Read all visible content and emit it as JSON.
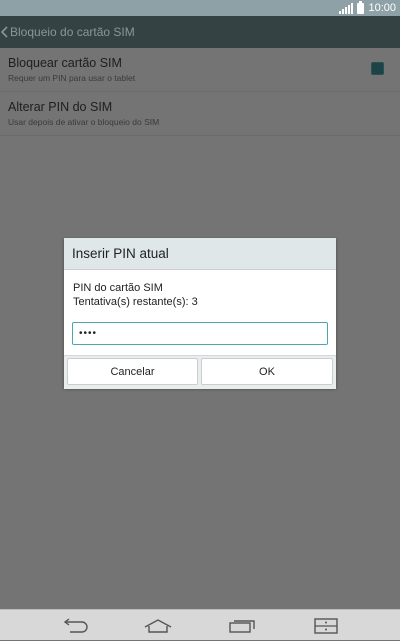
{
  "status_bar": {
    "time": "10:00",
    "icons": [
      "signal-icon",
      "battery-icon"
    ]
  },
  "action_bar": {
    "title": "Bloqueio do cartão SIM",
    "back_icon": "chevron-left-icon"
  },
  "settings": [
    {
      "title": "Bloquear cartão SIM",
      "subtitle": "Requer um PIN para usar o tablet",
      "checked": true
    },
    {
      "title": "Alterar PIN do SIM",
      "subtitle": "Usar depois de ativar o bloqueio do SIM"
    }
  ],
  "dialog": {
    "title": "Inserir PIN atual",
    "message_line1": "PIN do cartão SIM",
    "message_line2": "Tentativa(s) restante(s): 3",
    "pin_value": "••••",
    "cancel_label": "Cancelar",
    "ok_label": "OK"
  },
  "nav_bar": {
    "icons": [
      "back-icon",
      "home-icon",
      "recent-apps-icon",
      "menu-icon"
    ]
  },
  "colors": {
    "accent": "#4ea6ad",
    "action_bar": "#354244",
    "status_bar": "#8da1a6",
    "dim_background": "#747474"
  }
}
